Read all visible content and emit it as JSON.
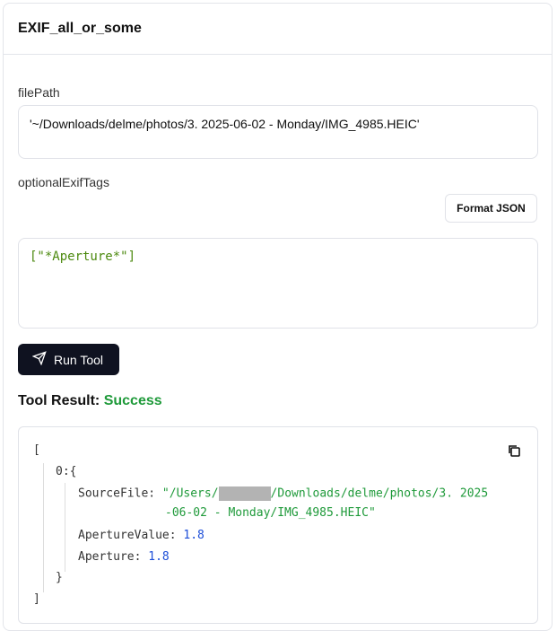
{
  "title": "EXIF_all_or_some",
  "filePath": {
    "label": "filePath",
    "value": "'~/Downloads/delme/photos/3. 2025-06-02 - Monday/IMG_4985.HEIC'"
  },
  "optionalExifTags": {
    "label": "optionalExifTags",
    "value": "[\"*Aperture*\"]",
    "format_label": "Format JSON"
  },
  "run_label": "Run Tool",
  "result": {
    "label": "Tool Result:",
    "status": "Success",
    "status_color": "#1f9a3a",
    "open_bracket": "[",
    "close_bracket": "]",
    "index": "0:",
    "open_brace": "{",
    "close_brace": "}",
    "fields": [
      {
        "key": "SourceFile:",
        "value_start": "\"/Users/",
        "value_rest": "/Downloads/delme/photos/3. 2025",
        "value_line2": "-06-02 - Monday/IMG_4985.HEIC\""
      },
      {
        "key": "ApertureValue:",
        "value": "1.8"
      },
      {
        "key": "Aperture:",
        "value": "1.8"
      }
    ]
  }
}
